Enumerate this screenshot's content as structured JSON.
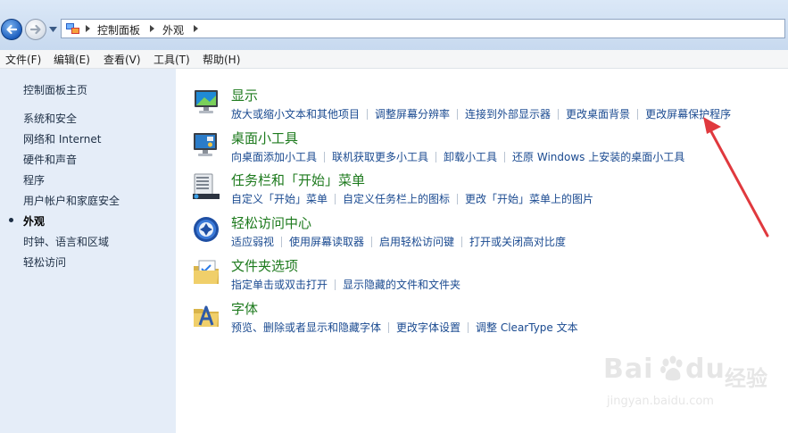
{
  "address_bar": {
    "breadcrumbs": [
      "控制面板",
      "外观"
    ]
  },
  "menu": [
    "文件(F)",
    "编辑(E)",
    "查看(V)",
    "工具(T)",
    "帮助(H)"
  ],
  "sidebar": {
    "home": "控制面板主页",
    "items": [
      "系统和安全",
      "网络和 Internet",
      "硬件和声音",
      "程序",
      "用户帐户和家庭安全",
      "外观",
      "时钟、语言和区域",
      "轻松访问"
    ],
    "current": "外观"
  },
  "categories": [
    {
      "icon": "display-icon",
      "title": "显示",
      "links": [
        "放大或缩小文本和其他项目",
        "调整屏幕分辨率",
        "连接到外部显示器",
        "更改桌面背景",
        "更改屏幕保护程序"
      ]
    },
    {
      "icon": "desktop-gadgets-icon",
      "title": "桌面小工具",
      "links": [
        "向桌面添加小工具",
        "联机获取更多小工具",
        "卸载小工具",
        "还原 Windows 上安装的桌面小工具"
      ]
    },
    {
      "icon": "taskbar-icon",
      "title": "任务栏和「开始」菜单",
      "links": [
        "自定义「开始」菜单",
        "自定义任务栏上的图标",
        "更改「开始」菜单上的图片"
      ]
    },
    {
      "icon": "ease-of-access-icon",
      "title": "轻松访问中心",
      "links": [
        "适应弱视",
        "使用屏幕读取器",
        "启用轻松访问键",
        "打开或关闭高对比度"
      ]
    },
    {
      "icon": "folder-options-icon",
      "title": "文件夹选项",
      "links": [
        "指定单击或双击打开",
        "显示隐藏的文件和文件夹"
      ]
    },
    {
      "icon": "fonts-icon",
      "title": "字体",
      "links": [
        "预览、删除或者显示和隐藏字体",
        "更改字体设置",
        "调整 ClearType 文本"
      ]
    }
  ],
  "watermark": {
    "brand": "Bai",
    "brand2": "经验",
    "url": "jingyan.baidu.com"
  },
  "colors": {
    "category_title": "#1d7a1d",
    "link": "#1a4a90",
    "sidebar_bg": "#e5edf8",
    "annotation_arrow": "#e0393e"
  }
}
